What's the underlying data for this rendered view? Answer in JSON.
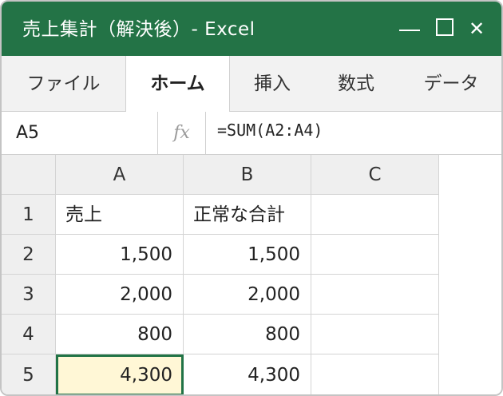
{
  "window": {
    "title": "売上集計（解決後）- Excel",
    "controls": {
      "minimize": "minimize-icon",
      "maximize": "maximize-icon",
      "close": "✕"
    }
  },
  "ribbon": {
    "tabs": [
      {
        "label": "ファイル",
        "active": false
      },
      {
        "label": "ホーム",
        "active": true
      },
      {
        "label": "挿入",
        "active": false
      },
      {
        "label": "数式",
        "active": false
      },
      {
        "label": "データ",
        "active": false
      }
    ]
  },
  "formula_bar": {
    "name_box": "A5",
    "fx_label": "fx",
    "formula": "=SUM(A2:A4)"
  },
  "sheet": {
    "columns": [
      "A",
      "B",
      "C"
    ],
    "rows": [
      {
        "num": "1",
        "A": "売上",
        "B": "正常な合計",
        "C": ""
      },
      {
        "num": "2",
        "A": "1,500",
        "B": "1,500",
        "C": ""
      },
      {
        "num": "3",
        "A": "2,000",
        "B": "2,000",
        "C": ""
      },
      {
        "num": "4",
        "A": "800",
        "B": "800",
        "C": ""
      },
      {
        "num": "5",
        "A": "4,300",
        "B": "4,300",
        "C": ""
      }
    ],
    "selected_cell": "A5"
  },
  "colors": {
    "title_bar": "#237346",
    "selection_border": "#217346",
    "selection_fill": "#fff7d6"
  }
}
